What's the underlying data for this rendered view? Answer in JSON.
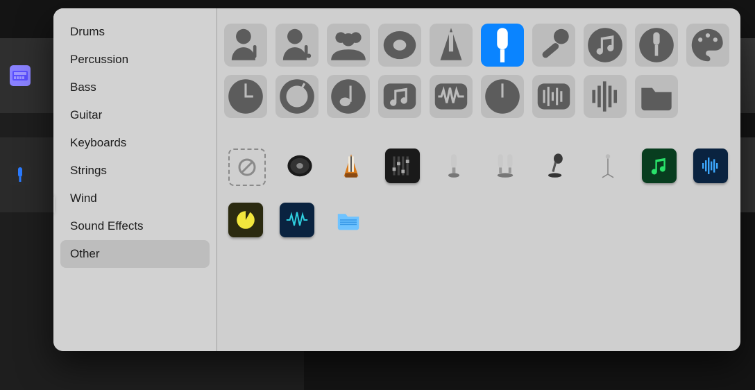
{
  "sidebar": {
    "items": [
      {
        "label": "Drums",
        "selected": false
      },
      {
        "label": "Percussion",
        "selected": false
      },
      {
        "label": "Bass",
        "selected": false
      },
      {
        "label": "Guitar",
        "selected": false
      },
      {
        "label": "Keyboards",
        "selected": false
      },
      {
        "label": "Strings",
        "selected": false
      },
      {
        "label": "Wind",
        "selected": false
      },
      {
        "label": "Sound Effects",
        "selected": false
      },
      {
        "label": "Other",
        "selected": true
      }
    ]
  },
  "icon_grid": {
    "row1": [
      {
        "name": "person-mic-icon",
        "selected": false
      },
      {
        "name": "person-mic-alt-icon",
        "selected": false
      },
      {
        "name": "group-icon",
        "selected": false
      },
      {
        "name": "speaker-cone-icon",
        "selected": false
      },
      {
        "name": "metronome-icon",
        "selected": false
      },
      {
        "name": "mic-capsule-icon",
        "selected": true
      },
      {
        "name": "handheld-mic-icon",
        "selected": false
      },
      {
        "name": "music-note-circle-icon",
        "selected": false
      },
      {
        "name": "plug-circle-icon",
        "selected": false
      },
      {
        "name": "palette-icon",
        "selected": false
      }
    ],
    "row2": [
      {
        "name": "clock-icon",
        "selected": false
      },
      {
        "name": "dial-icon",
        "selected": false
      },
      {
        "name": "note-circle-icon",
        "selected": false
      },
      {
        "name": "music-square-icon",
        "selected": false
      },
      {
        "name": "waveform-square-icon",
        "selected": false
      },
      {
        "name": "clock-alt-icon",
        "selected": false
      },
      {
        "name": "waveform-square-alt-icon",
        "selected": false
      },
      {
        "name": "audio-bars-icon",
        "selected": false
      },
      {
        "name": "folder-icon",
        "selected": false
      }
    ],
    "row3": [
      {
        "name": "none-tile",
        "style": "dashed"
      },
      {
        "name": "speaker-tile",
        "style": "real"
      },
      {
        "name": "metronome-tile",
        "style": "real"
      },
      {
        "name": "mixer-tile",
        "style": "real"
      },
      {
        "name": "condenser-mic-tile",
        "style": "real"
      },
      {
        "name": "stereo-mic-tile",
        "style": "real"
      },
      {
        "name": "desk-mic-tile",
        "style": "real"
      },
      {
        "name": "mic-stand-tile",
        "style": "real"
      },
      {
        "name": "music-green-tile",
        "style": "green"
      },
      {
        "name": "waveform-blue-tile",
        "style": "darkblue"
      }
    ],
    "row4": [
      {
        "name": "clock-yellow-tile",
        "style": "yellow"
      },
      {
        "name": "waveform-teal-tile",
        "style": "teal"
      },
      {
        "name": "folder-blue-tile",
        "style": "lightblue"
      }
    ]
  },
  "background_tracks": [
    {
      "name": "synth-track",
      "icon": "synth"
    },
    {
      "name": "mic-track",
      "icon": "mic"
    }
  ]
}
